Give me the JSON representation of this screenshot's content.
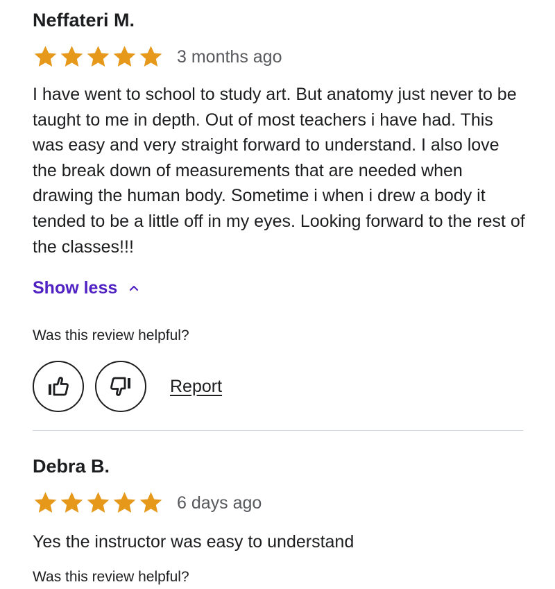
{
  "reviews": [
    {
      "name": "Neffateri M.",
      "rating": 5,
      "date": "3 months ago",
      "text": "I have went to school to study art. But anatomy just never to be taught to me in depth. Out of most teachers i have had. This was easy and very straight forward to understand. I also love the break down of measurements that are needed when drawing the human body. Sometime i when i drew a body it tended to be a little off in my eyes. Looking forward to the rest of the classes!!!",
      "show_less_label": "Show less",
      "helpful_prompt": "Was this review helpful?",
      "report_label": "Report"
    },
    {
      "name": "Debra B.",
      "rating": 5,
      "date": "6 days ago",
      "text": "Yes the instructor was easy to understand",
      "helpful_prompt": "Was this review helpful?"
    }
  ],
  "colors": {
    "star": "#e59819",
    "link_accent": "#5022c3",
    "text": "#1c1d1f",
    "muted": "#57595d",
    "divider": "#d1d7dc"
  },
  "icons": {
    "star": "star-icon",
    "chevron": "chevron-up-icon",
    "like": "thumbs-up-icon",
    "dislike": "thumbs-down-icon"
  }
}
